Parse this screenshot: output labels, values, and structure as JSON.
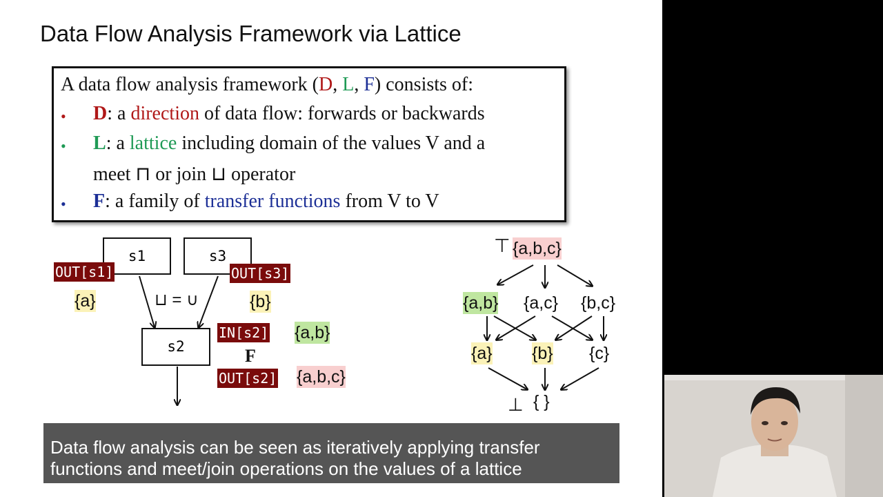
{
  "slide": {
    "title": "Data Flow Analysis Framework via Lattice",
    "definition": {
      "intro_pre": "A data flow analysis framework (",
      "intro_d": "D",
      "intro_comma1": ", ",
      "intro_l": "L",
      "intro_comma2": ", ",
      "intro_f": "F",
      "intro_post": ") consists of:",
      "bullet_glyph": "•",
      "item_d": {
        "key": "D",
        "pre": ": a ",
        "term": "direction",
        "post": " of data flow: forwards or backwards"
      },
      "item_l": {
        "key": "L",
        "pre": ": a ",
        "term": "lattice",
        "post": " including domain of the values V and a",
        "line2": "meet ⊓ or join ⊔ operator"
      },
      "item_f": {
        "key": "F",
        "pre": ": a family of ",
        "term": "transfer functions",
        "post": " from V to V"
      }
    },
    "cfg": {
      "s1": "s1",
      "s3": "s3",
      "s2": "s2",
      "out_s1": "OUT[s1]",
      "out_s3": "OUT[s3]",
      "val_s1": "{a}",
      "val_s3": "{b}",
      "join_label": "⊔ = ∪",
      "in_s2": "IN[s2]",
      "in_val": "{a,b}",
      "f_label": "F",
      "out_s2": "OUT[s2]",
      "out_val": "{a,b,c}"
    },
    "lattice": {
      "top_symbol": "⊤",
      "top": "{a,b,c}",
      "ab": "{a,b}",
      "ac": "{a,c}",
      "bc": "{b,c}",
      "a": "{a}",
      "b": "{b}",
      "c": "{c}",
      "bottom_symbol": "⊥",
      "bottom": "{ }"
    },
    "caption_line1": "Data flow analysis can be seen as iteratively applying transfer",
    "caption_line2": "functions and meet/join operations on the values of a lattice"
  },
  "colors": {
    "direction_red": "#b01818",
    "lattice_green": "#1f9a55",
    "transfer_blue": "#1c2f96",
    "tag_bg": "#7a0b0b",
    "caption_bg": "#555555"
  }
}
